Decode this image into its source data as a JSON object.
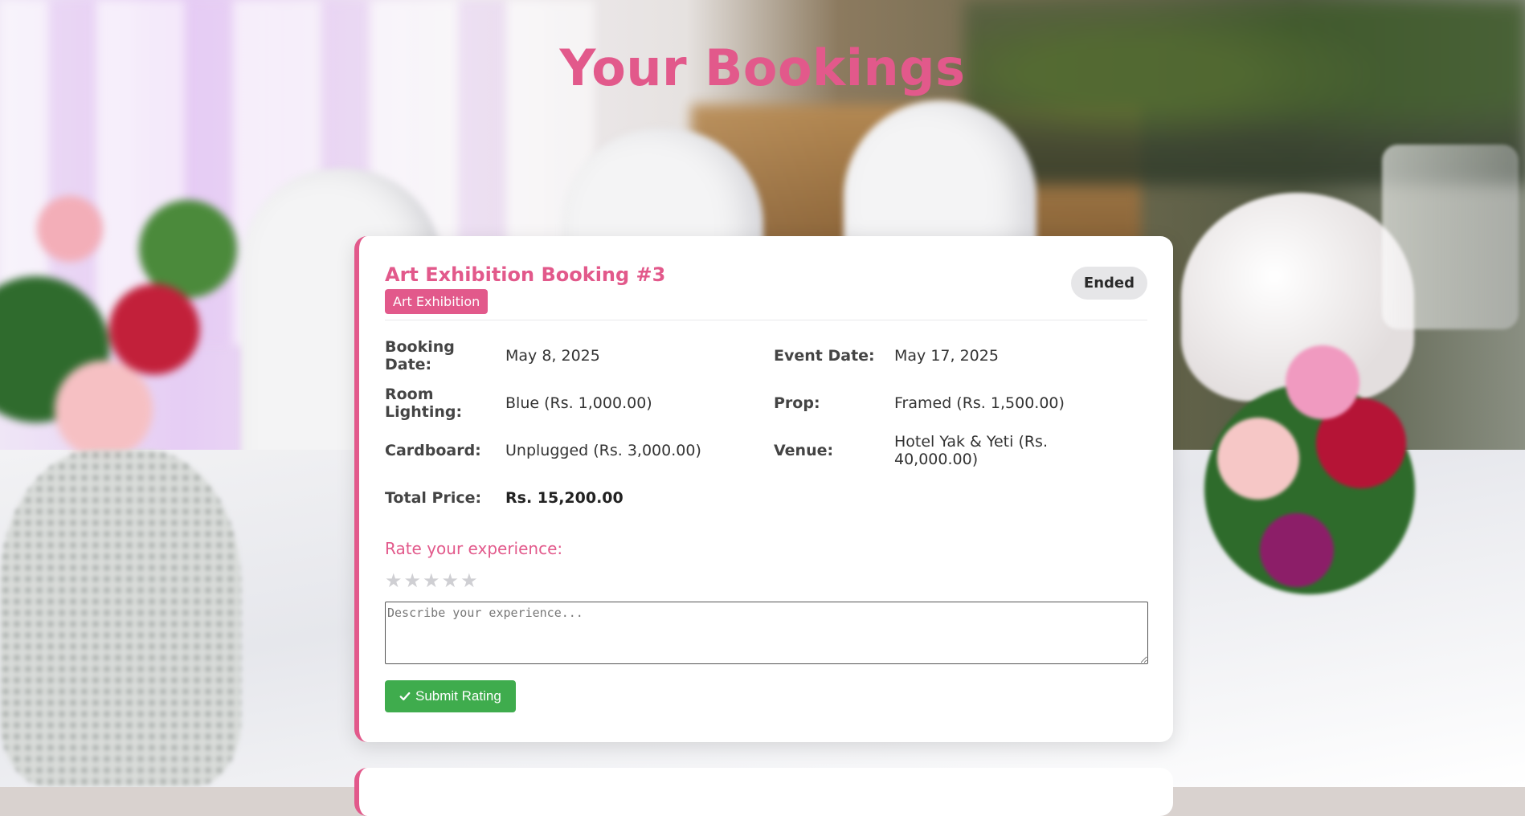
{
  "page": {
    "title": "Your Bookings"
  },
  "booking": {
    "title": "Art Exhibition Booking #3",
    "category": "Art Exhibition",
    "status": "Ended",
    "details": [
      {
        "label": "Booking Date:",
        "value": "May 8, 2025"
      },
      {
        "label": "Event Date:",
        "value": "May 17, 2025"
      },
      {
        "label": "Room Lighting:",
        "value": "Blue (Rs. 1,000.00)"
      },
      {
        "label": "Prop:",
        "value": "Framed (Rs. 1,500.00)"
      },
      {
        "label": "Cardboard:",
        "value": "Unplugged (Rs. 3,000.00)"
      },
      {
        "label": "Venue:",
        "value": "Hotel Yak & Yeti (Rs. 40,000.00)"
      },
      {
        "label": "Total Price:",
        "value": "Rs. 15,200.00"
      }
    ],
    "rating": {
      "prompt": "Rate your experience:",
      "max_stars": 5,
      "current_stars": 0,
      "placeholder": "Describe your experience...",
      "review_value": "",
      "submit_label": "Submit Rating"
    }
  },
  "colors": {
    "accent": "#e2598b",
    "success": "#3fac4d",
    "badge_neutral": "#e6e6e8",
    "star_empty": "#cfcfd3"
  },
  "icons": {
    "submit": "check-icon",
    "star": "star-icon"
  }
}
